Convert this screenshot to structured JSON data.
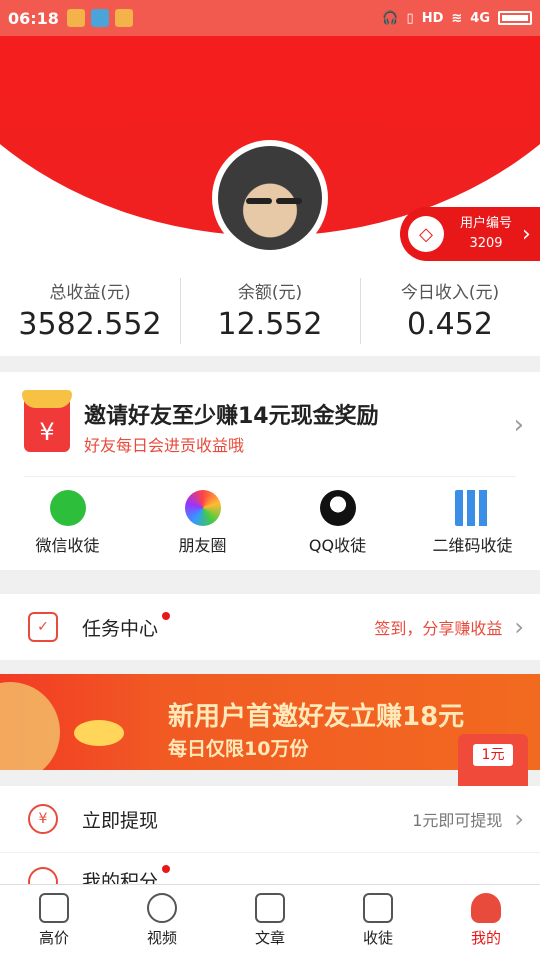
{
  "status_bar": {
    "time": "06:18",
    "network": "4G"
  },
  "user": {
    "badge_label": "用户编号",
    "id": "3209"
  },
  "stats": [
    {
      "label": "总收益(元)",
      "value": "3582.552"
    },
    {
      "label": "余额(元)",
      "value": "12.552"
    },
    {
      "label": "今日收入(元)",
      "value": "0.452"
    }
  ],
  "invite": {
    "title": "邀请好友至少赚14元现金奖励",
    "subtitle": "好友每日会进贡收益哦",
    "share": [
      {
        "label": "微信收徒",
        "icon": "wechat-icon"
      },
      {
        "label": "朋友圈",
        "icon": "moments-icon"
      },
      {
        "label": "QQ收徒",
        "icon": "qq-icon"
      },
      {
        "label": "二维码收徒",
        "icon": "qrcode-icon"
      }
    ]
  },
  "tasks": {
    "label": "任务中心",
    "right": "签到，分享赚收益"
  },
  "banner": {
    "title": "新用户首邀好友立赚18元",
    "subtitle": "每日仅限10万份"
  },
  "float_bag": {
    "label": "1元"
  },
  "withdraw": {
    "label": "立即提现",
    "right": "1元即可提现"
  },
  "points": {
    "label": "我的积分"
  },
  "nav": [
    {
      "label": "高价",
      "icon": "money-bag-icon"
    },
    {
      "label": "视频",
      "icon": "play-icon"
    },
    {
      "label": "文章",
      "icon": "document-icon"
    },
    {
      "label": "收徒",
      "icon": "wallet-icon"
    },
    {
      "label": "我的",
      "icon": "profile-icon"
    }
  ],
  "colors": {
    "primary": "#e81818",
    "accent": "#e84b3c"
  }
}
